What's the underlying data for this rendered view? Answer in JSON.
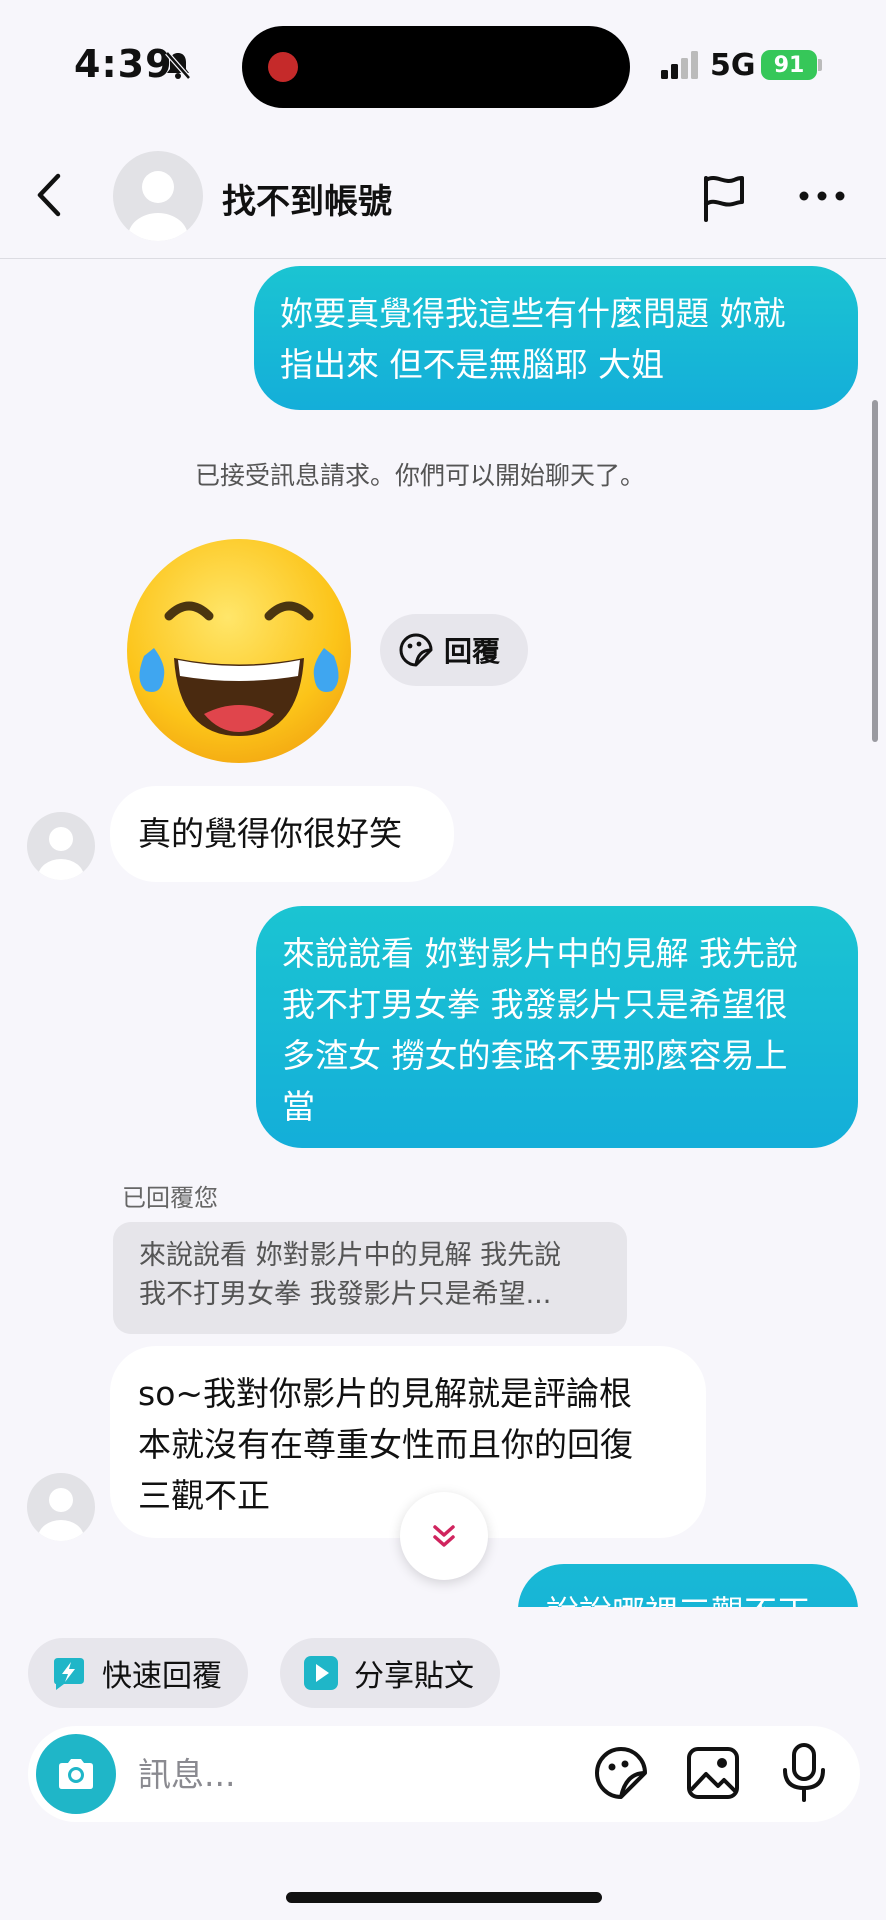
{
  "status_bar": {
    "time": "4:39",
    "network": "5G",
    "battery": "91",
    "icons": [
      "bell-slash-icon",
      "signal-icon",
      "battery-charging-icon"
    ]
  },
  "header": {
    "name": "找不到帳號",
    "icons": [
      "back-icon",
      "avatar-placeholder",
      "flag-icon",
      "more-icon"
    ]
  },
  "messages": {
    "m1": {
      "from": "me",
      "lines": [
        "妳要真覺得我這些有什麼問題 妳就",
        "指出來 但不是無腦耶 大姐"
      ]
    },
    "system_note": "已接受訊息請求。你們可以開始聊天了。",
    "emoji": "face-with-tears-of-joy",
    "reply_button": "回覆",
    "m2": {
      "from": "them",
      "text": "真的覺得你很好笑"
    },
    "m3": {
      "from": "me",
      "lines": [
        "來說說看 妳對影片中的見解 我先說",
        "我不打男女拳 我發影片只是希望很",
        "多渣女 撈女的套路不要那麼容易上",
        "當"
      ]
    },
    "replied_label": "已回覆您",
    "quote_lines": [
      "來說說看 妳對影片中的見解 我先說",
      "我不打男女拳 我發影片只是希望..."
    ],
    "m4": {
      "from": "them",
      "lines": [
        "so~我對你影片的見解就是評論根",
        "本就沒有在尊重女性而且你的回復",
        "三觀不正"
      ]
    },
    "m5_partial": {
      "from": "me",
      "text": "說說哪裡三觀不正"
    }
  },
  "chips": {
    "quick_reply": "快速回覆",
    "share_post": "分享貼文"
  },
  "composer": {
    "placeholder": "訊息..."
  },
  "colors": {
    "bubble_out": "#14aed9",
    "bubble_in": "#ffffff",
    "background": "#f7f6fb",
    "camera_button": "#1fb6c8",
    "battery": "#36c759",
    "scroll_chevron": "#d0245e"
  }
}
